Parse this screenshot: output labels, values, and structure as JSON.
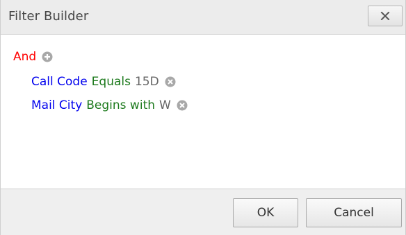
{
  "dialog": {
    "title": "Filter Builder",
    "close_icon": "close-icon"
  },
  "filter": {
    "group": {
      "operator": "And",
      "add_icon": "plus-circle-icon"
    },
    "conditions": [
      {
        "field": "Call Code",
        "operator": "Equals",
        "value": "15D",
        "remove_icon": "remove-circle-icon"
      },
      {
        "field": "Mail City",
        "operator": "Begins with",
        "value": "W",
        "remove_icon": "remove-circle-icon"
      }
    ]
  },
  "footer": {
    "ok_label": "OK",
    "cancel_label": "Cancel"
  },
  "colors": {
    "group_operator": "#ff0000",
    "field": "#0000ee",
    "condition_operator": "#1d7a1d",
    "value": "#666666"
  }
}
